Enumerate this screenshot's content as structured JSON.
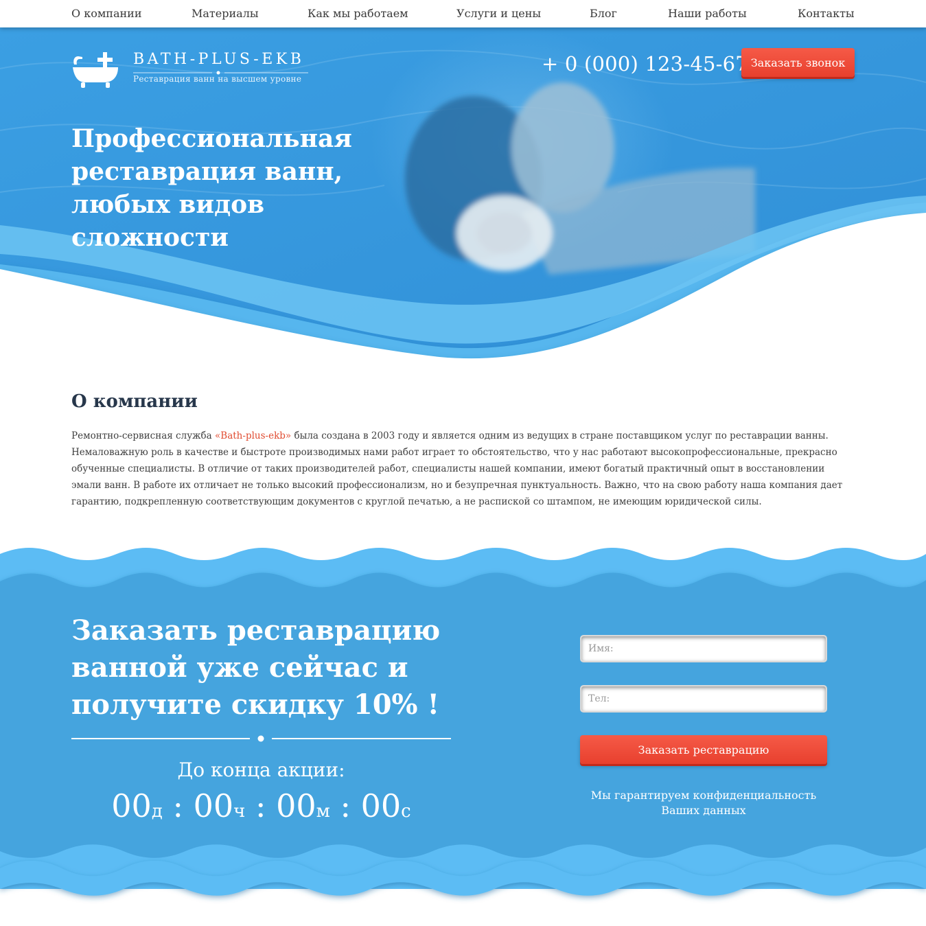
{
  "nav": {
    "items": [
      {
        "id": "about",
        "label": "О компании"
      },
      {
        "id": "materials",
        "label": "Материалы"
      },
      {
        "id": "how",
        "label": "Как мы работаем"
      },
      {
        "id": "services",
        "label": "Услуги и цены"
      },
      {
        "id": "blog",
        "label": "Блог"
      },
      {
        "id": "works",
        "label": "Наши работы"
      },
      {
        "id": "contacts",
        "label": "Контакты"
      }
    ]
  },
  "header": {
    "logo_title": "BATH-PLUS-EKB",
    "logo_subtitle": "Реставрация ванн на высшем уровне",
    "logo_icon": "bathtub-plus-icon",
    "phone": "+ 0 (000) 123-45-67",
    "call_button": "Заказать звонок"
  },
  "hero": {
    "title": "Профессиональная реставрация ванн, любых видов сложности"
  },
  "about": {
    "title": "О компании",
    "text_before": "Ремонтно-сервисная служба ",
    "brand": "«Bath-plus-ekb»",
    "text_after": " была создана в 2003 году и является одним из ведущих в стране поставщиком услуг по реставрации ванны. Немаловажную роль в качестве и быстроте производимых нами работ играет то обстоятельство, что у нас работают высокопрофессиональные, прекрасно обученные специалисты. В отличие от таких производителей работ, специалисты нашей компании, имеют богатый практичный опыт в восстановлении эмали ванн. В работе их отличает не только высокий профессионализм, но и безупречная пунктуальность. Важно, что на свою работу наша компания дает гарантию, подкрепленную соответствующим документов с круглой печатью, а не распиской со штампом, не имеющим юридической силы."
  },
  "order": {
    "title": "Заказать реставрацию ванной уже сейчас и получите скидку 10% !",
    "timer_label": "До конца акции:",
    "timer": {
      "days": "00",
      "days_unit": "д",
      "hours": "00",
      "hours_unit": "ч",
      "minutes": "00",
      "minutes_unit": "м",
      "seconds": "00",
      "seconds_unit": "с",
      "separator": ":"
    },
    "name_placeholder": "Имя:",
    "phone_placeholder": "Тел:",
    "submit": "Заказать реставрацию",
    "privacy": "Мы гарантируем конфиденциальность Ваших данных"
  },
  "colors": {
    "hero_blue": "#3a9de0",
    "section_blue": "#45a4de",
    "wave_light": "#5cbcf4",
    "accent_red": "#ef4b38",
    "heading_dark": "#27374b"
  }
}
